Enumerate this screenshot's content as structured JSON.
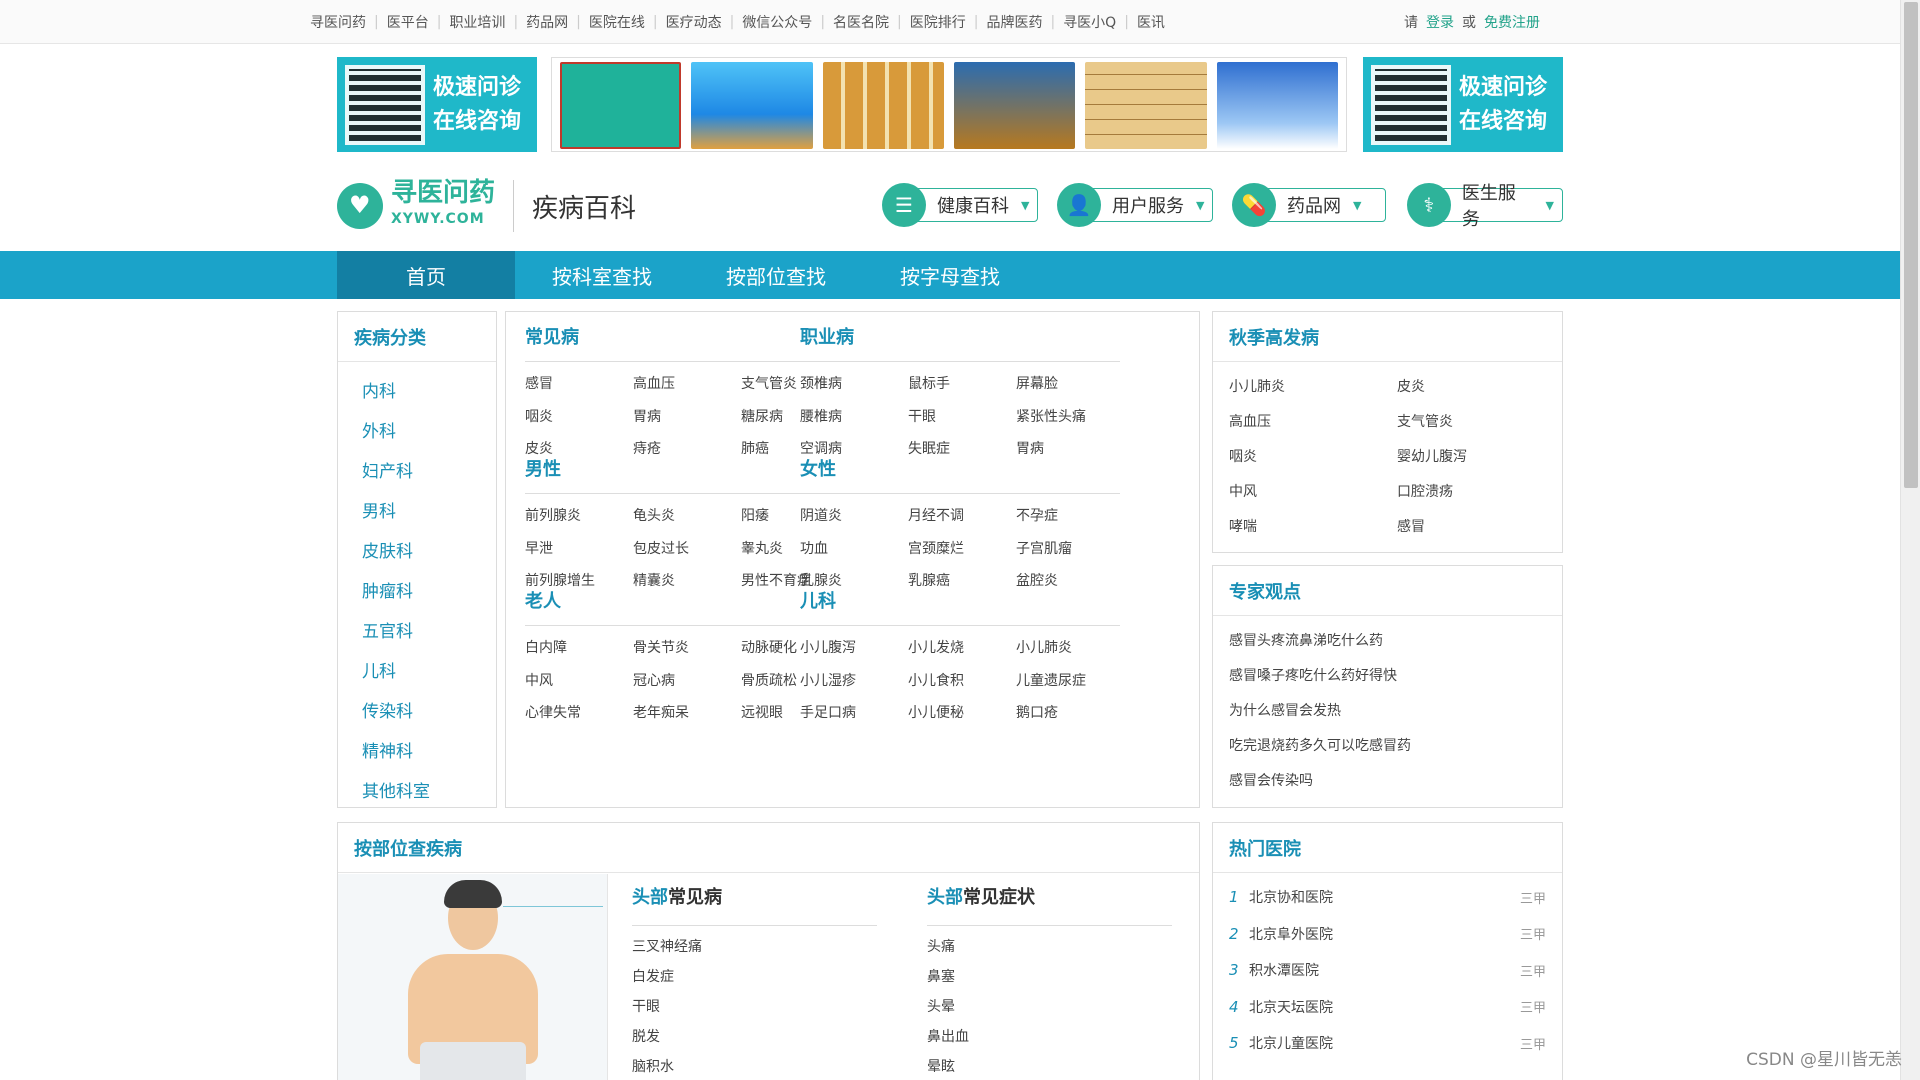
{
  "topbar": {
    "links": [
      "寻医问药",
      "医平台",
      "职业培训",
      "药品网",
      "医院在线",
      "医疗动态",
      "微信公众号",
      "名医名院",
      "医院排行",
      "品牌医药",
      "寻医小Q",
      "医讯"
    ],
    "please": "请",
    "login": "登录",
    "or": "或",
    "register": "免费注册"
  },
  "banners": {
    "qr_text_1": "极速问诊",
    "qr_text_2": "在线咨询",
    "games_count": 6
  },
  "logo": {
    "brand": "寻医问药",
    "domain": "XYWY.COM",
    "section": "疾病百科"
  },
  "services": [
    {
      "label": "健康百科",
      "icon": "list-icon"
    },
    {
      "label": "用户服务",
      "icon": "user-icon"
    },
    {
      "label": "药品网",
      "icon": "pill-icon"
    },
    {
      "label": "医生服务",
      "icon": "doctor-icon"
    }
  ],
  "nav": [
    "首页",
    "按科室查找",
    "按部位查找",
    "按字母查找"
  ],
  "categories": {
    "title": "疾病分类",
    "items": [
      "内科",
      "外科",
      "妇产科",
      "男科",
      "皮肤科",
      "肿瘤科",
      "五官科",
      "儿科",
      "传染科",
      "精神科",
      "其他科室"
    ]
  },
  "groups": [
    {
      "title": "常见病",
      "items": [
        "感冒",
        "高血压",
        "支气管炎",
        "咽炎",
        "胃病",
        "糖尿病",
        "皮炎",
        "痔疮",
        "肺癌"
      ]
    },
    {
      "title": "职业病",
      "items": [
        "颈椎病",
        "鼠标手",
        "屏幕脸",
        "腰椎病",
        "干眼",
        "紧张性头痛",
        "空调病",
        "失眠症",
        "胃病"
      ]
    },
    {
      "title": "男性",
      "items": [
        "前列腺炎",
        "龟头炎",
        "阳痿",
        "早泄",
        "包皮过长",
        "睾丸炎",
        "前列腺增生",
        "精囊炎",
        "男性不育症"
      ]
    },
    {
      "title": "女性",
      "items": [
        "阴道炎",
        "月经不调",
        "不孕症",
        "功血",
        "宫颈糜烂",
        "子宫肌瘤",
        "乳腺炎",
        "乳腺癌",
        "盆腔炎"
      ]
    },
    {
      "title": "老人",
      "items": [
        "白内障",
        "骨关节炎",
        "动脉硬化",
        "中风",
        "冠心病",
        "骨质疏松",
        "心律失常",
        "老年痴呆",
        "远视眼"
      ]
    },
    {
      "title": "儿科",
      "items": [
        "小儿腹泻",
        "小儿发烧",
        "小儿肺炎",
        "小儿湿疹",
        "小儿食积",
        "儿童遗尿症",
        "手足口病",
        "小儿便秘",
        "鹅口疮"
      ]
    }
  ],
  "autumn": {
    "title": "秋季高发病",
    "items": [
      "小儿肺炎",
      "皮炎",
      "高血压",
      "支气管炎",
      "咽炎",
      "婴幼儿腹泻",
      "中风",
      "口腔溃疡",
      "哮喘",
      "感冒"
    ]
  },
  "expert": {
    "title": "专家观点",
    "items": [
      "感冒头疼流鼻涕吃什么药",
      "感冒嗓子疼吃什么药好得快",
      "为什么感冒会发热",
      "吃完退烧药多久可以吃感冒药",
      "感冒会传染吗"
    ]
  },
  "bypart": {
    "title": "按部位查疾病",
    "part": "头部",
    "diseases_suffix": "常见病",
    "symptoms_suffix": "常见症状",
    "diseases": [
      "三叉神经痛",
      "白发症",
      "干眼",
      "脱发",
      "脑积水"
    ],
    "symptoms": [
      "头痛",
      "鼻塞",
      "头晕",
      "鼻出血",
      "晕眩"
    ]
  },
  "hospitals": {
    "title": "热门医院",
    "items": [
      {
        "no": "1",
        "name": "北京协和医院",
        "level": "三甲"
      },
      {
        "no": "2",
        "name": "北京阜外医院",
        "level": "三甲"
      },
      {
        "no": "3",
        "name": "积水潭医院",
        "level": "三甲"
      },
      {
        "no": "4",
        "name": "北京天坛医院",
        "level": "三甲"
      },
      {
        "no": "5",
        "name": "北京儿童医院",
        "level": "三甲"
      }
    ]
  },
  "watermark": "CSDN @星川皆无恙",
  "colors": {
    "accent": "#1ba3c9",
    "nav_active": "#137fa3",
    "brand_green": "#2eb39a",
    "link_blue": "#1a8fb5"
  }
}
